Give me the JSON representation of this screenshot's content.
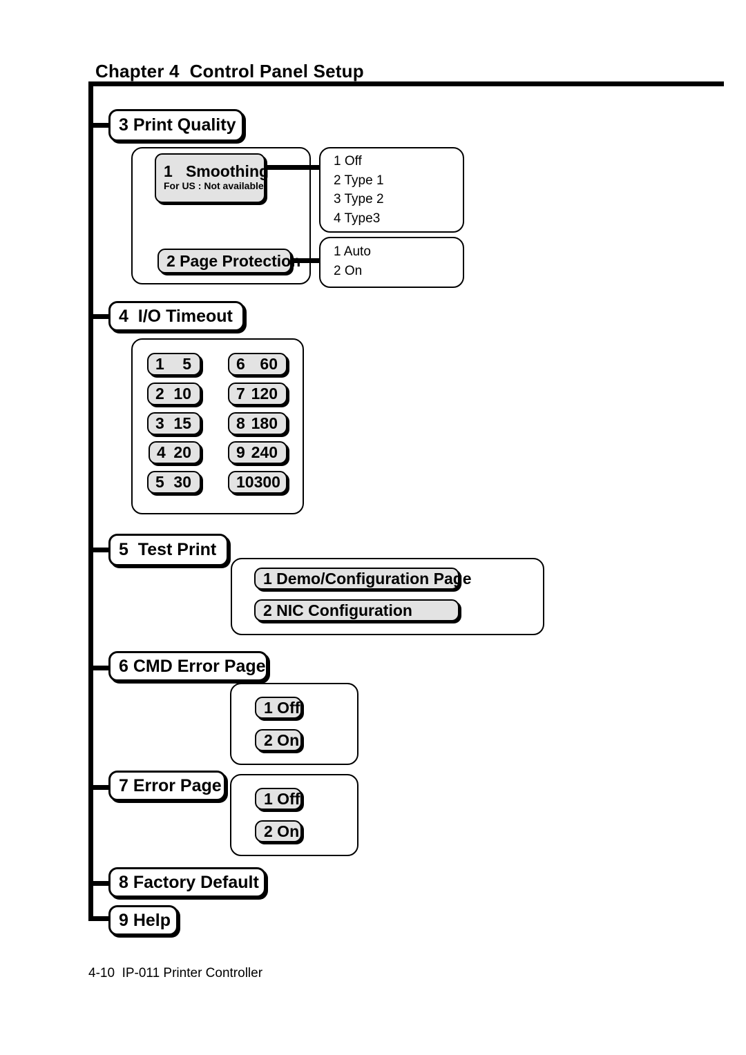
{
  "header": {
    "chapter": "Chapter 4  Control Panel Setup"
  },
  "footer": {
    "text": "4-10  IP-011 Printer Controller"
  },
  "menu": {
    "items": [
      {
        "label": "3 Print Quality"
      },
      {
        "label": "4  I/O Timeout"
      },
      {
        "label": "5  Test Print"
      },
      {
        "label": "6 CMD Error Page"
      },
      {
        "label": "7 Error Page"
      },
      {
        "label": "8 Factory Default"
      },
      {
        "label": "9 Help"
      }
    ]
  },
  "print_quality": {
    "smoothing": {
      "label": "1   Smoothing",
      "note": "For US : Not available",
      "options": [
        "1 Off",
        "2 Type 1",
        "3 Type 2",
        "4 Type3"
      ]
    },
    "page_protection": {
      "label": "2 Page Protection",
      "options": [
        "1 Auto",
        "2 On"
      ]
    }
  },
  "io_timeout": {
    "values": [
      {
        "idx": "1",
        "val": "5"
      },
      {
        "idx": "2",
        "val": "10"
      },
      {
        "idx": "3",
        "val": "15"
      },
      {
        "idx": "4",
        "val": "20"
      },
      {
        "idx": "5",
        "val": "30"
      },
      {
        "idx": "6",
        "val": "60"
      },
      {
        "idx": "7",
        "val": "120"
      },
      {
        "idx": "8",
        "val": "180"
      },
      {
        "idx": "9",
        "val": "240"
      },
      {
        "idx": "10",
        "val": "300"
      }
    ]
  },
  "test_print": {
    "options": [
      "1 Demo/Configuration Page",
      "2 NIC Configuration"
    ]
  },
  "cmd_error_page": {
    "options": [
      "1 Off",
      "2 On"
    ]
  },
  "error_page": {
    "options": [
      "1 Off",
      "2 On"
    ]
  },
  "colors": {
    "line": "#000000",
    "chip_fill": "#e3e3e3",
    "page": "#ffffff"
  }
}
